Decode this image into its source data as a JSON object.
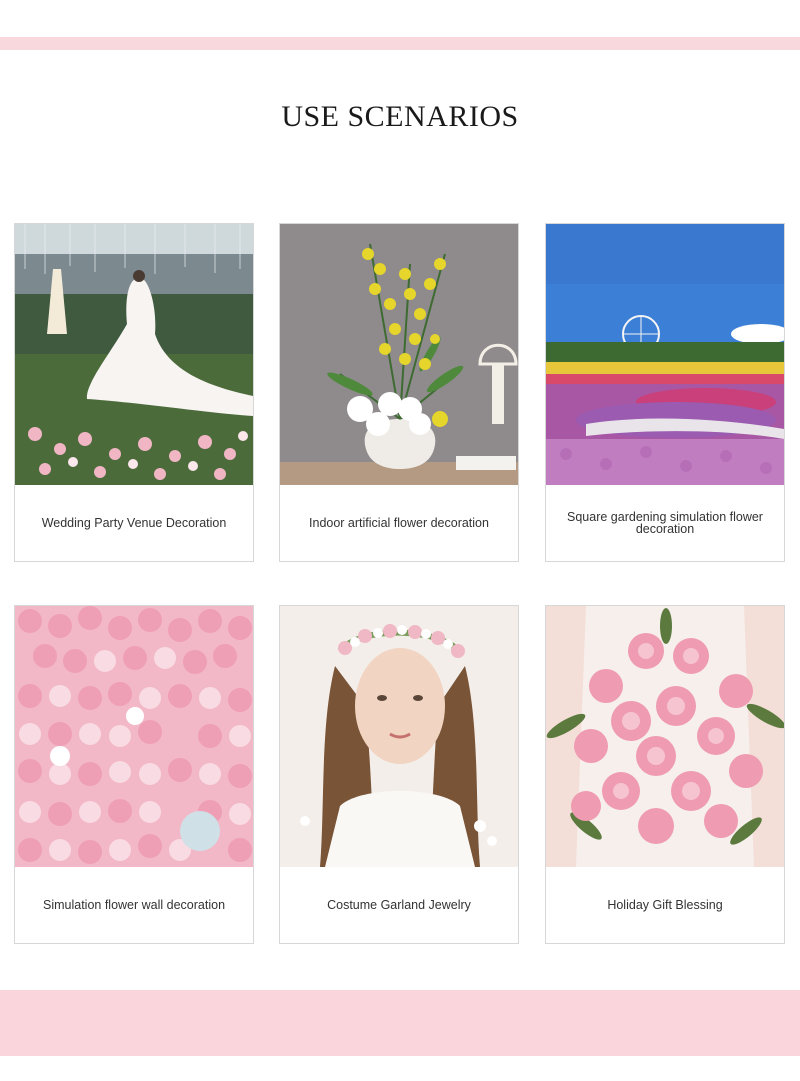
{
  "section": {
    "title": "USE SCENARIOS"
  },
  "scenarios": [
    {
      "caption": "Wedding Party Venue Decoration",
      "image": "wedding-venue-photo"
    },
    {
      "caption": "Indoor artificial flower decoration",
      "image": "indoor-vase-photo"
    },
    {
      "caption": "Square gardening simulation flower decoration",
      "image": "flower-garden-photo"
    },
    {
      "caption": "Simulation flower wall decoration",
      "image": "rose-wall-photo"
    },
    {
      "caption": "Costume Garland Jewelry",
      "image": "flower-crown-photo"
    },
    {
      "caption": "Holiday Gift Blessing",
      "image": "rose-bouquet-photo"
    }
  ],
  "colors": {
    "accent_pink": "#f8d7dd",
    "border": "#d7d7d7"
  }
}
